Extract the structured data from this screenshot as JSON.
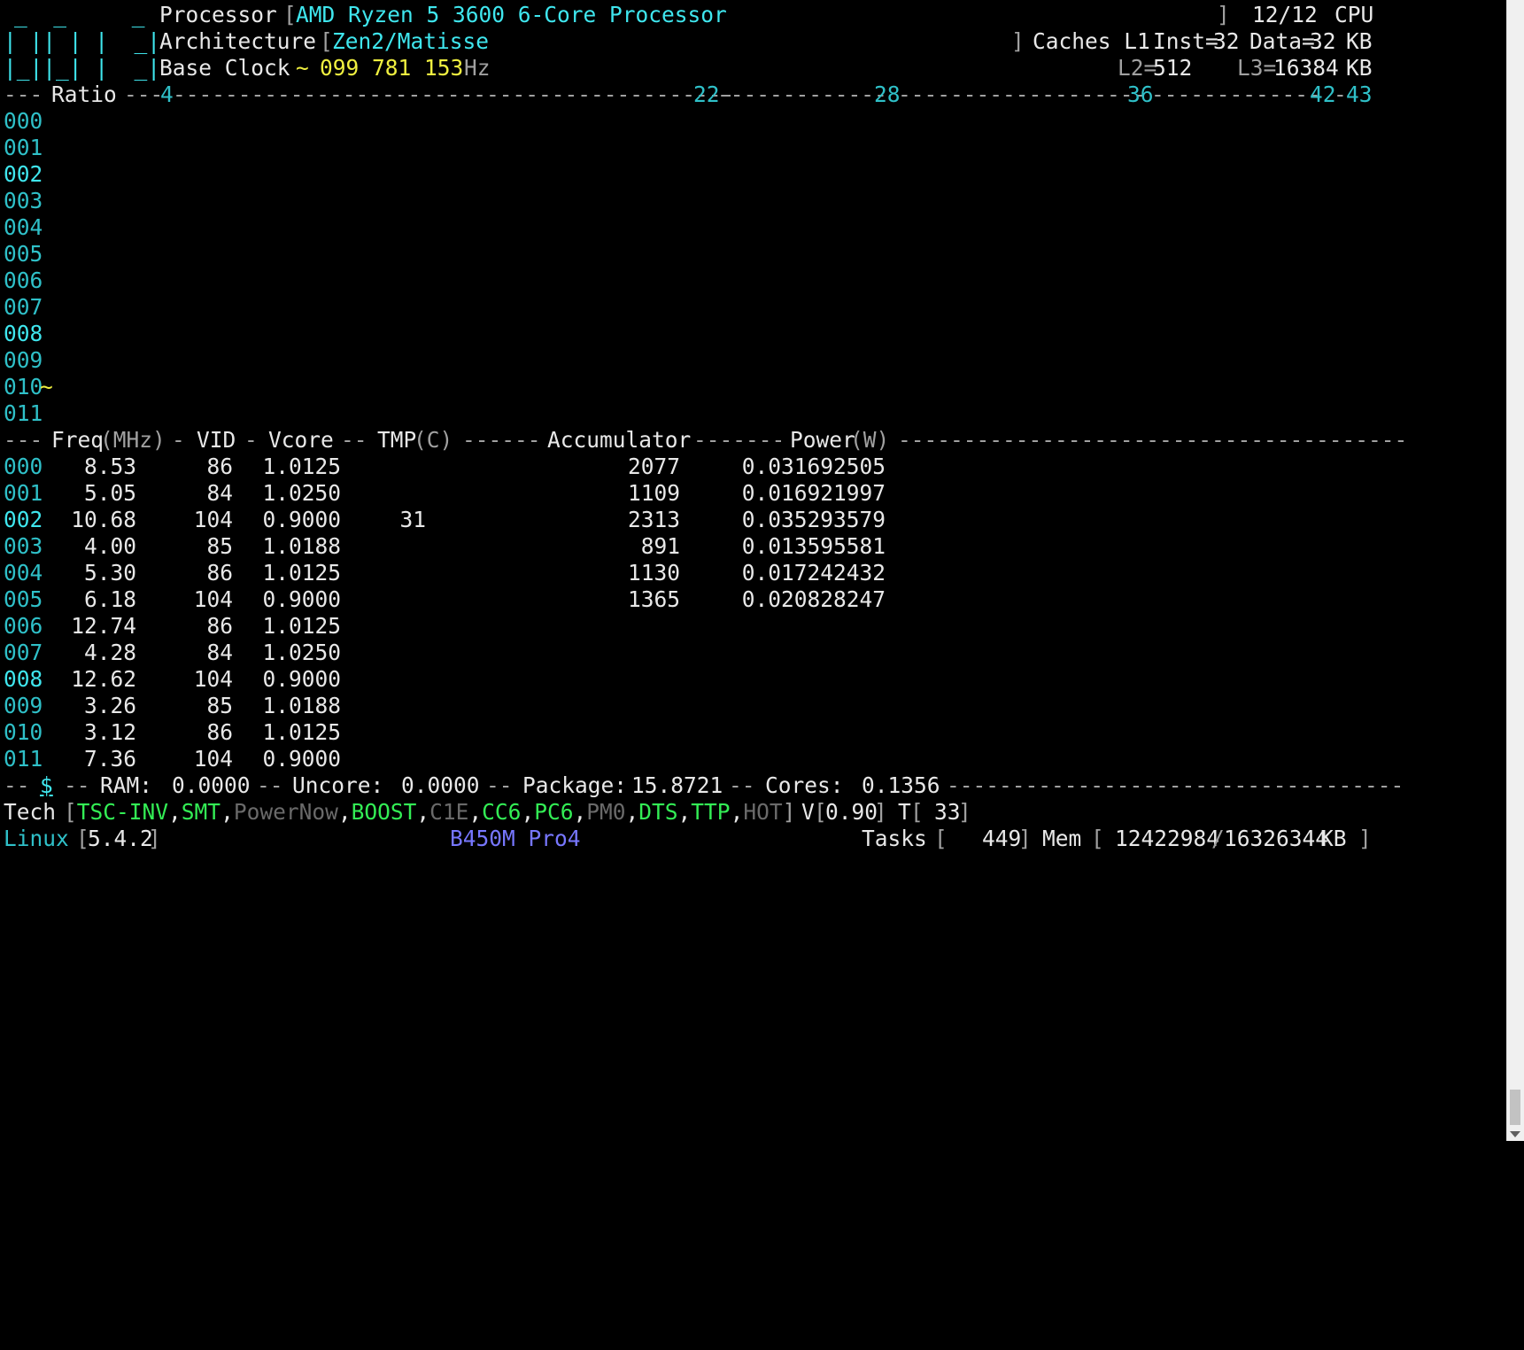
{
  "header": {
    "logo_lines": [
      "_  _     _",
      "| || | |  _|",
      "|_||_| |  _|"
    ],
    "processor_label": "Processor",
    "processor_value": "AMD Ryzen 5 3600 6-Core Processor",
    "cpu_count": "12/12",
    "cpu_label": "CPU",
    "architecture_label": "Architecture",
    "architecture_value": "Zen2/Matisse",
    "caches_label": "Caches L1",
    "l1_inst_label": "Inst=",
    "l1_inst_value": "32",
    "l1_data_label": "Data=",
    "l1_data_value": "32",
    "kb_unit": "KB",
    "base_clock_label": "Base Clock",
    "base_clock_tilde": "~",
    "base_clock_value": "099 781 153",
    "hz_unit": "Hz",
    "l2_label": "L2=",
    "l2_value": "512",
    "l3_label": "L3=",
    "l3_value": "16384"
  },
  "ratio_bar": {
    "label": "Ratio",
    "markers": [
      "4",
      "22",
      "28",
      "36",
      "42",
      "43"
    ]
  },
  "cores": [
    "000",
    "001",
    "002",
    "003",
    "004",
    "005",
    "006",
    "007",
    "008",
    "009",
    "010",
    "011"
  ],
  "core_marker": {
    "core": "010",
    "symbol": "~"
  },
  "freq_header": {
    "freq": "Freq",
    "freq_unit": "(MHz)",
    "vid": "VID",
    "vcore": "Vcore",
    "tmp": "TMP",
    "tmp_unit": "(C)",
    "accumulator": "Accumulator",
    "power": "Power",
    "power_unit": "(W)"
  },
  "freq_rows": [
    {
      "core": "000",
      "freq": "8.53",
      "vid": "86",
      "vcore": "1.0125",
      "tmp": "",
      "accumulator": "2077",
      "power": "0.031692505"
    },
    {
      "core": "001",
      "freq": "5.05",
      "vid": "84",
      "vcore": "1.0250",
      "tmp": "",
      "accumulator": "1109",
      "power": "0.016921997"
    },
    {
      "core": "002",
      "freq": "10.68",
      "vid": "104",
      "vcore": "0.9000",
      "tmp": "31",
      "accumulator": "2313",
      "power": "0.035293579"
    },
    {
      "core": "003",
      "freq": "4.00",
      "vid": "85",
      "vcore": "1.0188",
      "tmp": "",
      "accumulator": "891",
      "power": "0.013595581"
    },
    {
      "core": "004",
      "freq": "5.30",
      "vid": "86",
      "vcore": "1.0125",
      "tmp": "",
      "accumulator": "1130",
      "power": "0.017242432"
    },
    {
      "core": "005",
      "freq": "6.18",
      "vid": "104",
      "vcore": "0.9000",
      "tmp": "",
      "accumulator": "1365",
      "power": "0.020828247"
    },
    {
      "core": "006",
      "freq": "12.74",
      "vid": "86",
      "vcore": "1.0125",
      "tmp": "",
      "accumulator": "",
      "power": ""
    },
    {
      "core": "007",
      "freq": "4.28",
      "vid": "84",
      "vcore": "1.0250",
      "tmp": "",
      "accumulator": "",
      "power": ""
    },
    {
      "core": "008",
      "freq": "12.62",
      "vid": "104",
      "vcore": "0.9000",
      "tmp": "",
      "accumulator": "",
      "power": ""
    },
    {
      "core": "009",
      "freq": "3.26",
      "vid": "85",
      "vcore": "1.0188",
      "tmp": "",
      "accumulator": "",
      "power": ""
    },
    {
      "core": "010",
      "freq": "3.12",
      "vid": "86",
      "vcore": "1.0125",
      "tmp": "",
      "accumulator": "",
      "power": ""
    },
    {
      "core": "011",
      "freq": "7.36",
      "vid": "104",
      "vcore": "0.9000",
      "tmp": "",
      "accumulator": "",
      "power": ""
    }
  ],
  "energy_bar": {
    "dollar": "$",
    "ram_label": "RAM:",
    "ram_value": "0.0000",
    "uncore_label": "Uncore:",
    "uncore_value": "0.0000",
    "package_label": "Package:",
    "package_value": "15.8721",
    "cores_label": "Cores:",
    "cores_value": "0.1356"
  },
  "tech": {
    "label": "Tech",
    "features": [
      {
        "name": "TSC-INV",
        "on": true
      },
      {
        "name": "SMT",
        "on": true
      },
      {
        "name": "PowerNow",
        "on": false
      },
      {
        "name": "BOOST",
        "on": true
      },
      {
        "name": "C1E",
        "on": false
      },
      {
        "name": "CC6",
        "on": true
      },
      {
        "name": "PC6",
        "on": true
      },
      {
        "name": "PM0",
        "on": false
      },
      {
        "name": "DTS",
        "on": true
      },
      {
        "name": "TTP",
        "on": true
      },
      {
        "name": "HOT",
        "on": false
      }
    ],
    "v_label": "V",
    "v_value": "0.90",
    "t_label": "T",
    "t_value": "33"
  },
  "footer": {
    "os_label": "Linux",
    "os_version": "5.4.2",
    "board": "B450M Pro4",
    "tasks_label": "Tasks",
    "tasks_value": "449",
    "mem_label": "Mem",
    "mem_used": "12422984",
    "mem_total": "16326344",
    "mem_unit": "KB"
  },
  "colors": {
    "background": "#000000",
    "cyan": "#2fc0c8",
    "yellow": "#f0f040",
    "green": "#33ee55",
    "board_blue": "#7777ff"
  }
}
